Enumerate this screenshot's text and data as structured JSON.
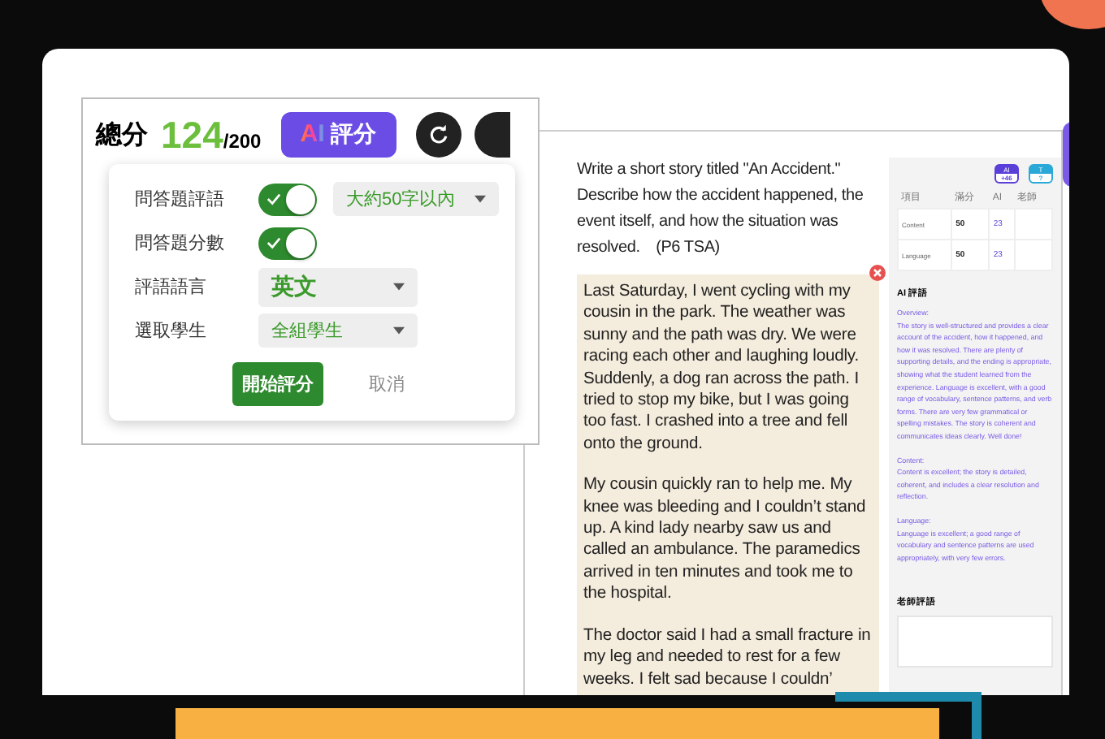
{
  "score": {
    "label": "總分",
    "value": "124",
    "total": "/200"
  },
  "ai_button": {
    "mark": "AI",
    "label": "評分"
  },
  "settings": [
    {
      "kind": "toggle",
      "label": "問答題評語",
      "on": true,
      "select": "大約50字以內"
    },
    {
      "kind": "toggle",
      "label": "問答題分數",
      "on": true
    },
    {
      "kind": "select",
      "label": "評語語言",
      "select": "英文",
      "large": true
    },
    {
      "kind": "select",
      "label": "選取學生",
      "select": "全組學生"
    }
  ],
  "actions": {
    "start": "開始評分",
    "cancel": "取消"
  },
  "question": "Write a short story titled \"An Accident.\" Describe how the accident happened, the event itself, and how the situation was resolved.　(P6 TSA)",
  "essay": [
    "Last Saturday, I went cycling with my cousin in the park. The weather was sunny and the path was dry. We were racing each other and laughing loudly. Suddenly, a dog ran across the path. I tried to stop my bike, but I was going too fast. I crashed into a tree and fell onto the ground.",
    "My cousin quickly ran to help me. My knee was bleeding and I couldn’t stand up. A kind lady nearby saw us and called an ambulance. The paramedics arrived in ten minutes and took me to the hospital.",
    "The doctor said I had a small fracture in my leg and needed to rest for a few weeks. I felt sad because I couldn’"
  ],
  "badges": [
    {
      "top": "AI",
      "bottom": "+46",
      "color": "#5b3fd9"
    },
    {
      "top": "T",
      "bottom": "?",
      "color": "#2aa8d8"
    }
  ],
  "table": {
    "columns": [
      "項目",
      "滿分",
      "AI",
      "老師"
    ],
    "rows": [
      [
        "Content",
        "50",
        "23"
      ],
      [
        "Language",
        "50",
        "23"
      ]
    ]
  },
  "ai_comment": {
    "title": "AI 評語",
    "paragraphs": [
      "Overview:",
      "The story is well-structured and provides a clear account of the accident, how it happened, and how it was resolved. There are plenty of supporting details, and the ending is appropriate, showing what the student learned from the experience. Language is excellent, with a good range of vocabulary, sentence patterns, and verb forms. There are very few grammatical or spelling mistakes. The story is coherent and communicates ideas clearly. Well done!",
      "Content:",
      "Content is excellent; the story is detailed, coherent, and includes a clear resolution and reflection.",
      "Language:",
      "Language is excellent; a good range of vocabulary and sentence patterns are used appropriately, with very few errors."
    ]
  },
  "teacher_comment": {
    "title": "老師評語"
  }
}
